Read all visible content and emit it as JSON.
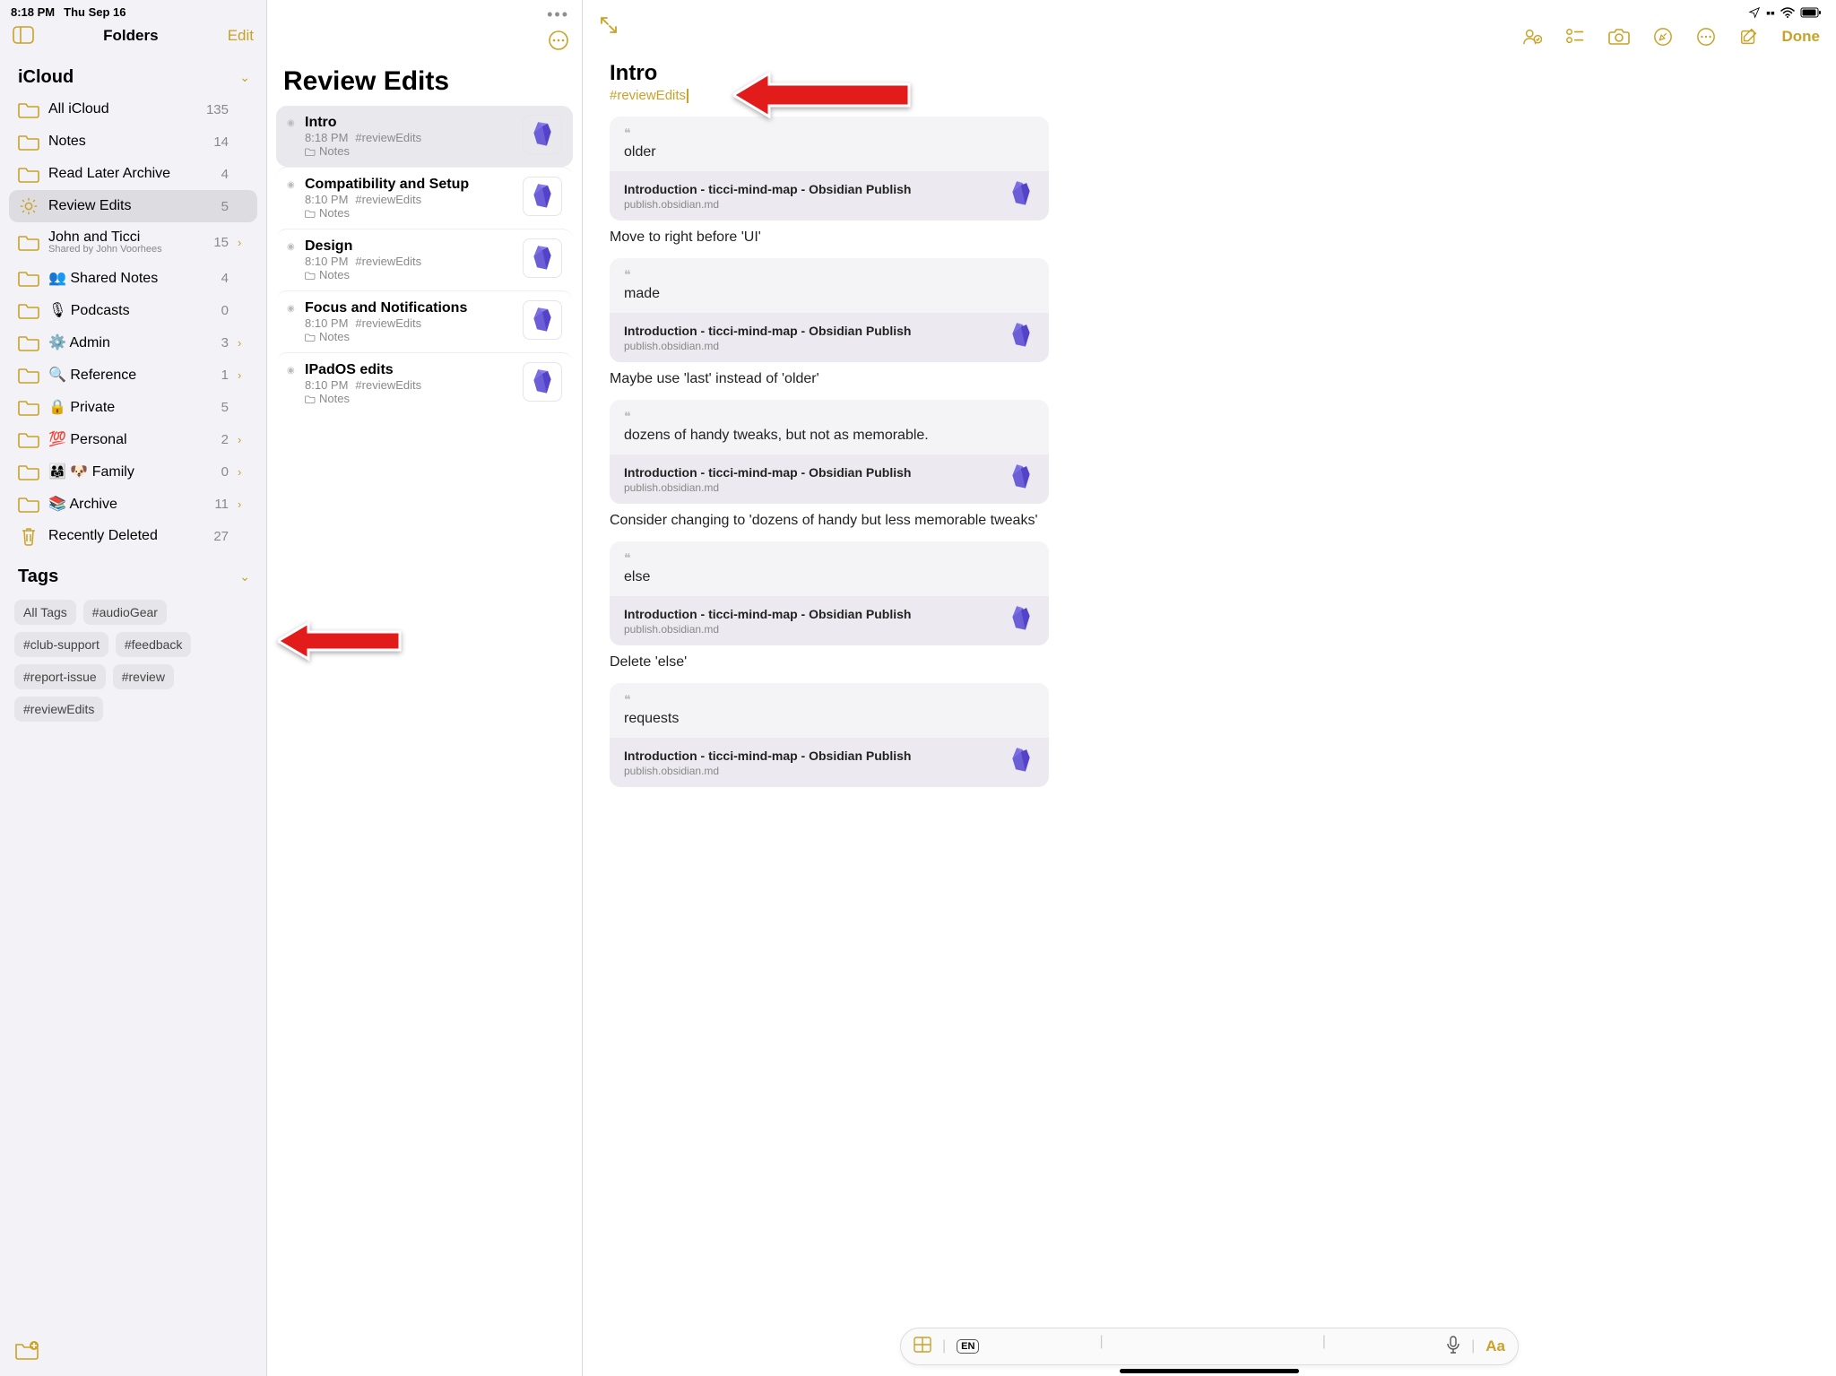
{
  "statusbar": {
    "time": "8:18 PM",
    "date": "Thu Sep 16"
  },
  "sidebar": {
    "title": "Folders",
    "edit": "Edit",
    "section_icloud": "iCloud",
    "section_tags": "Tags",
    "folders": [
      {
        "name": "All iCloud",
        "count": "135",
        "icon": "folder",
        "chev": false
      },
      {
        "name": "Notes",
        "count": "14",
        "icon": "folder",
        "chev": false
      },
      {
        "name": "Read Later Archive",
        "count": "4",
        "icon": "folder",
        "chev": false
      },
      {
        "name": "Review Edits",
        "count": "5",
        "icon": "gear",
        "chev": false,
        "selected": true
      },
      {
        "name": "John and Ticci",
        "sub": "Shared by John Voorhees",
        "count": "15",
        "icon": "folder",
        "chev": true
      },
      {
        "name": "👥 Shared Notes",
        "count": "4",
        "icon": "folder",
        "chev": false
      },
      {
        "name": "🎙 Podcasts",
        "count": "0",
        "icon": "folder",
        "chev": false
      },
      {
        "name": "⚙️ Admin",
        "count": "3",
        "icon": "folder",
        "chev": true
      },
      {
        "name": "🔍 Reference",
        "count": "1",
        "icon": "folder",
        "chev": true
      },
      {
        "name": "🔒 Private",
        "count": "5",
        "icon": "folder",
        "chev": false
      },
      {
        "name": "💯 Personal",
        "count": "2",
        "icon": "folder",
        "chev": true
      },
      {
        "name": "👨‍👩‍👧 🐶 Family",
        "count": "0",
        "icon": "folder",
        "chev": true
      },
      {
        "name": "📚 Archive",
        "count": "11",
        "icon": "folder",
        "chev": true
      },
      {
        "name": "Recently Deleted",
        "count": "27",
        "icon": "trash",
        "chev": false
      }
    ],
    "tags": [
      "All Tags",
      "#audioGear",
      "#club-support",
      "#feedback",
      "#report-issue",
      "#review",
      "#reviewEdits"
    ]
  },
  "notelist": {
    "title": "Review Edits",
    "items": [
      {
        "title": "Intro",
        "time": "8:18 PM",
        "tag": "#reviewEdits",
        "folder": "Notes",
        "selected": true
      },
      {
        "title": "Compatibility and Setup",
        "time": "8:10 PM",
        "tag": "#reviewEdits",
        "folder": "Notes"
      },
      {
        "title": "Design",
        "time": "8:10 PM",
        "tag": "#reviewEdits",
        "folder": "Notes"
      },
      {
        "title": "Focus and Notifications",
        "time": "8:10 PM",
        "tag": "#reviewEdits",
        "folder": "Notes"
      },
      {
        "title": "IPadOS edits",
        "time": "8:10 PM",
        "tag": "#reviewEdits",
        "folder": "Notes"
      }
    ]
  },
  "editor": {
    "done": "Done",
    "title": "Intro",
    "tag": "#reviewEdits",
    "link_title": "Introduction - ticci-mind-map - Obsidian Publish",
    "link_url": "publish.obsidian.md",
    "blocks": [
      {
        "quote": "older",
        "comment": "Move to right before 'UI'"
      },
      {
        "quote": "made",
        "comment": "Maybe use 'last' instead of 'older'"
      },
      {
        "quote": "dozens of handy tweaks, but not as memorable.",
        "comment": "Consider changing to 'dozens of handy but less memorable tweaks'"
      },
      {
        "quote": "else",
        "comment": "Delete 'else'"
      },
      {
        "quote": "requests",
        "comment": ""
      }
    ]
  },
  "keyboard": {
    "lang": "EN",
    "format": "Aa"
  }
}
